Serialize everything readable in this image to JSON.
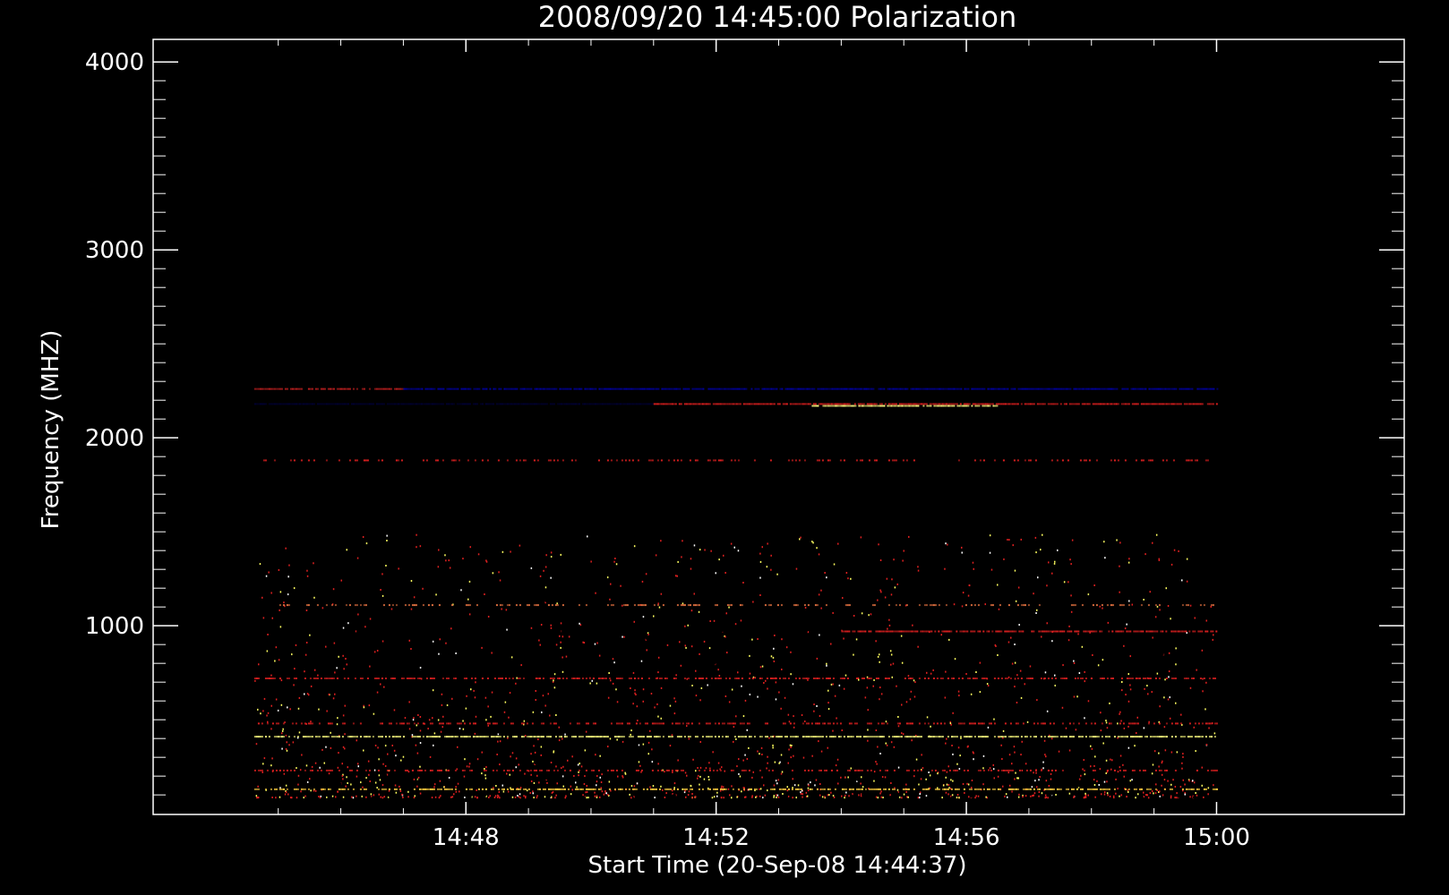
{
  "chart_data": {
    "type": "heatmap",
    "title": "2008/09/20 14:45:00 Polarization",
    "xlabel": "Start Time (20-Sep-08 14:44:37)",
    "ylabel": "Frequency (MHZ)",
    "x_start": "14:44:37",
    "x_end": "15:00:00",
    "xlim": [
      "14:43:00",
      "15:03:00"
    ],
    "ylim": [
      4120,
      -4
    ],
    "data_y_range": [
      90,
      4020
    ],
    "x_ticks": [
      "14:48",
      "14:52",
      "14:56",
      "15:00"
    ],
    "y_ticks": [
      1000,
      2000,
      3000,
      4000
    ],
    "background_color": "#0a00f0",
    "colormap": [
      "#000000",
      "#0000ff",
      "#e02020",
      "#ffff60",
      "#ffffff"
    ],
    "bands": [
      {
        "freq": 130,
        "width": 12,
        "start": "14:44:37",
        "end": "15:00:00",
        "color": "#ffd040",
        "density": 0.55
      },
      {
        "freq": 230,
        "width": 14,
        "start": "14:44:37",
        "end": "15:00:00",
        "color": "#e02020",
        "density": 0.35
      },
      {
        "freq": 410,
        "width": 14,
        "start": "14:44:37",
        "end": "15:00:00",
        "color": "#ffff80",
        "density": 0.7
      },
      {
        "freq": 480,
        "width": 8,
        "start": "14:44:37",
        "end": "15:00:00",
        "color": "#e02020",
        "density": 0.4
      },
      {
        "freq": 720,
        "width": 8,
        "start": "14:44:37",
        "end": "15:00:00",
        "color": "#e02020",
        "density": 0.5
      },
      {
        "freq": 970,
        "width": 20,
        "start": "14:44:37",
        "end": "14:54:00",
        "color": "#000000",
        "density": 0.6
      },
      {
        "freq": 970,
        "width": 20,
        "start": "14:54:00",
        "end": "15:00:00",
        "color": "#e02020",
        "density": 0.75
      },
      {
        "freq": 1110,
        "width": 10,
        "start": "14:44:37",
        "end": "15:00:00",
        "color": "#e07040",
        "density": 0.3
      },
      {
        "freq": 1880,
        "width": 10,
        "start": "14:44:37",
        "end": "15:00:00",
        "color": "#e02020",
        "density": 0.25
      },
      {
        "freq": 2180,
        "width": 50,
        "start": "14:44:37",
        "end": "14:51:00",
        "color": "#000033",
        "density": 0.9
      },
      {
        "freq": 2180,
        "width": 50,
        "start": "14:51:00",
        "end": "15:00:00",
        "color": "#e02020",
        "density": 0.9
      },
      {
        "freq": 2170,
        "width": 25,
        "start": "14:53:30",
        "end": "14:56:30",
        "color": "#ffff80",
        "density": 0.9
      },
      {
        "freq": 2260,
        "width": 18,
        "start": "14:44:37",
        "end": "14:47:00",
        "color": "#c02020",
        "density": 0.8
      },
      {
        "freq": 2260,
        "width": 18,
        "start": "14:47:00",
        "end": "15:00:00",
        "color": "#0000a0",
        "density": 0.9
      }
    ]
  }
}
